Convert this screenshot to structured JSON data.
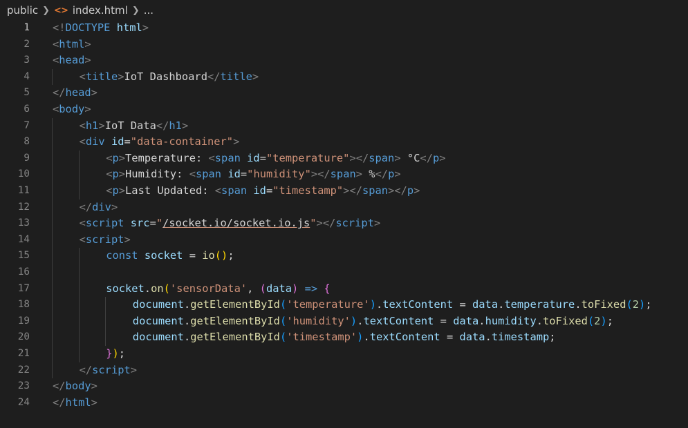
{
  "breadcrumb": {
    "folder": "public",
    "file": "index.html",
    "more": "..."
  },
  "editor": {
    "active_line": 1,
    "lines": [
      {
        "n": "1",
        "indent": 0,
        "tokens": [
          [
            "brk",
            "<!"
          ],
          [
            "tag",
            "DOCTYPE"
          ],
          [
            "txt",
            " "
          ],
          [
            "attr",
            "html"
          ],
          [
            "brk",
            ">"
          ]
        ]
      },
      {
        "n": "2",
        "indent": 0,
        "tokens": [
          [
            "brk",
            "<"
          ],
          [
            "tag",
            "html"
          ],
          [
            "brk",
            ">"
          ]
        ]
      },
      {
        "n": "3",
        "indent": 0,
        "tokens": [
          [
            "brk",
            "<"
          ],
          [
            "tag",
            "head"
          ],
          [
            "brk",
            ">"
          ]
        ]
      },
      {
        "n": "4",
        "indent": 1,
        "tokens": [
          [
            "brk",
            "<"
          ],
          [
            "tag",
            "title"
          ],
          [
            "brk",
            ">"
          ],
          [
            "txt",
            "IoT Dashboard"
          ],
          [
            "brk",
            "</"
          ],
          [
            "tag",
            "title"
          ],
          [
            "brk",
            ">"
          ]
        ]
      },
      {
        "n": "5",
        "indent": 0,
        "tokens": [
          [
            "brk",
            "</"
          ],
          [
            "tag",
            "head"
          ],
          [
            "brk",
            ">"
          ]
        ]
      },
      {
        "n": "6",
        "indent": 0,
        "tokens": [
          [
            "brk",
            "<"
          ],
          [
            "tag",
            "body"
          ],
          [
            "brk",
            ">"
          ]
        ]
      },
      {
        "n": "7",
        "indent": 1,
        "tokens": [
          [
            "brk",
            "<"
          ],
          [
            "tag",
            "h1"
          ],
          [
            "brk",
            ">"
          ],
          [
            "txt",
            "IoT Data"
          ],
          [
            "brk",
            "</"
          ],
          [
            "tag",
            "h1"
          ],
          [
            "brk",
            ">"
          ]
        ]
      },
      {
        "n": "8",
        "indent": 1,
        "tokens": [
          [
            "brk",
            "<"
          ],
          [
            "tag",
            "div"
          ],
          [
            "txt",
            " "
          ],
          [
            "attr",
            "id"
          ],
          [
            "txt",
            "="
          ],
          [
            "str",
            "\"data-container\""
          ],
          [
            "brk",
            ">"
          ]
        ]
      },
      {
        "n": "9",
        "indent": 2,
        "tokens": [
          [
            "brk",
            "<"
          ],
          [
            "tag",
            "p"
          ],
          [
            "brk",
            ">"
          ],
          [
            "txt",
            "Temperature: "
          ],
          [
            "brk",
            "<"
          ],
          [
            "tag",
            "span"
          ],
          [
            "txt",
            " "
          ],
          [
            "attr",
            "id"
          ],
          [
            "txt",
            "="
          ],
          [
            "str",
            "\"temperature\""
          ],
          [
            "brk",
            "></"
          ],
          [
            "tag",
            "span"
          ],
          [
            "brk",
            ">"
          ],
          [
            "txt",
            " °C"
          ],
          [
            "brk",
            "</"
          ],
          [
            "tag",
            "p"
          ],
          [
            "brk",
            ">"
          ]
        ]
      },
      {
        "n": "10",
        "indent": 2,
        "tokens": [
          [
            "brk",
            "<"
          ],
          [
            "tag",
            "p"
          ],
          [
            "brk",
            ">"
          ],
          [
            "txt",
            "Humidity: "
          ],
          [
            "brk",
            "<"
          ],
          [
            "tag",
            "span"
          ],
          [
            "txt",
            " "
          ],
          [
            "attr",
            "id"
          ],
          [
            "txt",
            "="
          ],
          [
            "str",
            "\"humidity\""
          ],
          [
            "brk",
            "></"
          ],
          [
            "tag",
            "span"
          ],
          [
            "brk",
            ">"
          ],
          [
            "txt",
            " %"
          ],
          [
            "brk",
            "</"
          ],
          [
            "tag",
            "p"
          ],
          [
            "brk",
            ">"
          ]
        ]
      },
      {
        "n": "11",
        "indent": 2,
        "tokens": [
          [
            "brk",
            "<"
          ],
          [
            "tag",
            "p"
          ],
          [
            "brk",
            ">"
          ],
          [
            "txt",
            "Last Updated: "
          ],
          [
            "brk",
            "<"
          ],
          [
            "tag",
            "span"
          ],
          [
            "txt",
            " "
          ],
          [
            "attr",
            "id"
          ],
          [
            "txt",
            "="
          ],
          [
            "str",
            "\"timestamp\""
          ],
          [
            "brk",
            "></"
          ],
          [
            "tag",
            "span"
          ],
          [
            "brk",
            "></"
          ],
          [
            "tag",
            "p"
          ],
          [
            "brk",
            ">"
          ]
        ]
      },
      {
        "n": "12",
        "indent": 1,
        "tokens": [
          [
            "brk",
            "</"
          ],
          [
            "tag",
            "div"
          ],
          [
            "brk",
            ">"
          ]
        ]
      },
      {
        "n": "13",
        "indent": 1,
        "tokens": [
          [
            "brk",
            "<"
          ],
          [
            "tag",
            "script"
          ],
          [
            "txt",
            " "
          ],
          [
            "attr",
            "src"
          ],
          [
            "txt",
            "="
          ],
          [
            "str",
            "\""
          ],
          [
            "link",
            "/socket.io/socket.io.js"
          ],
          [
            "str",
            "\""
          ],
          [
            "brk",
            "></"
          ],
          [
            "tag",
            "script"
          ],
          [
            "brk",
            ">"
          ]
        ]
      },
      {
        "n": "14",
        "indent": 1,
        "tokens": [
          [
            "brk",
            "<"
          ],
          [
            "tag",
            "script"
          ],
          [
            "brk",
            ">"
          ]
        ]
      },
      {
        "n": "15",
        "indent": 2,
        "tokens": [
          [
            "kw",
            "const"
          ],
          [
            "txt",
            " "
          ],
          [
            "var",
            "socket"
          ],
          [
            "txt",
            " = "
          ],
          [
            "fn",
            "io"
          ],
          [
            "b1",
            "()"
          ],
          [
            "txt",
            ";"
          ]
        ]
      },
      {
        "n": "16",
        "indent": 0,
        "tokens": []
      },
      {
        "n": "17",
        "indent": 2,
        "tokens": [
          [
            "var",
            "socket"
          ],
          [
            "txt",
            "."
          ],
          [
            "fn",
            "on"
          ],
          [
            "b1",
            "("
          ],
          [
            "str",
            "'sensorData'"
          ],
          [
            "txt",
            ", "
          ],
          [
            "b2",
            "("
          ],
          [
            "var",
            "data"
          ],
          [
            "b2",
            ")"
          ],
          [
            "txt",
            " "
          ],
          [
            "kw",
            "=>"
          ],
          [
            "txt",
            " "
          ],
          [
            "b2",
            "{"
          ]
        ]
      },
      {
        "n": "18",
        "indent": 3,
        "tokens": [
          [
            "var",
            "document"
          ],
          [
            "txt",
            "."
          ],
          [
            "fn",
            "getElementById"
          ],
          [
            "b3",
            "("
          ],
          [
            "str",
            "'temperature'"
          ],
          [
            "b3",
            ")"
          ],
          [
            "txt",
            "."
          ],
          [
            "var",
            "textContent"
          ],
          [
            "txt",
            " = "
          ],
          [
            "var",
            "data"
          ],
          [
            "txt",
            "."
          ],
          [
            "var",
            "temperature"
          ],
          [
            "txt",
            "."
          ],
          [
            "fn",
            "toFixed"
          ],
          [
            "b3",
            "("
          ],
          [
            "num",
            "2"
          ],
          [
            "b3",
            ")"
          ],
          [
            "txt",
            ";"
          ]
        ]
      },
      {
        "n": "19",
        "indent": 3,
        "tokens": [
          [
            "var",
            "document"
          ],
          [
            "txt",
            "."
          ],
          [
            "fn",
            "getElementById"
          ],
          [
            "b3",
            "("
          ],
          [
            "str",
            "'humidity'"
          ],
          [
            "b3",
            ")"
          ],
          [
            "txt",
            "."
          ],
          [
            "var",
            "textContent"
          ],
          [
            "txt",
            " = "
          ],
          [
            "var",
            "data"
          ],
          [
            "txt",
            "."
          ],
          [
            "var",
            "humidity"
          ],
          [
            "txt",
            "."
          ],
          [
            "fn",
            "toFixed"
          ],
          [
            "b3",
            "("
          ],
          [
            "num",
            "2"
          ],
          [
            "b3",
            ")"
          ],
          [
            "txt",
            ";"
          ]
        ]
      },
      {
        "n": "20",
        "indent": 3,
        "tokens": [
          [
            "var",
            "document"
          ],
          [
            "txt",
            "."
          ],
          [
            "fn",
            "getElementById"
          ],
          [
            "b3",
            "("
          ],
          [
            "str",
            "'timestamp'"
          ],
          [
            "b3",
            ")"
          ],
          [
            "txt",
            "."
          ],
          [
            "var",
            "textContent"
          ],
          [
            "txt",
            " = "
          ],
          [
            "var",
            "data"
          ],
          [
            "txt",
            "."
          ],
          [
            "var",
            "timestamp"
          ],
          [
            "txt",
            ";"
          ]
        ]
      },
      {
        "n": "21",
        "indent": 2,
        "tokens": [
          [
            "b2",
            "}"
          ],
          [
            "b1",
            ")"
          ],
          [
            "txt",
            ";"
          ]
        ]
      },
      {
        "n": "22",
        "indent": 1,
        "tokens": [
          [
            "brk",
            "</"
          ],
          [
            "tag",
            "script"
          ],
          [
            "brk",
            ">"
          ]
        ]
      },
      {
        "n": "23",
        "indent": 0,
        "tokens": [
          [
            "brk",
            "</"
          ],
          [
            "tag",
            "body"
          ],
          [
            "brk",
            ">"
          ]
        ]
      },
      {
        "n": "24",
        "indent": 0,
        "tokens": [
          [
            "brk",
            "</"
          ],
          [
            "tag",
            "html"
          ],
          [
            "brk",
            ">"
          ]
        ]
      }
    ]
  }
}
